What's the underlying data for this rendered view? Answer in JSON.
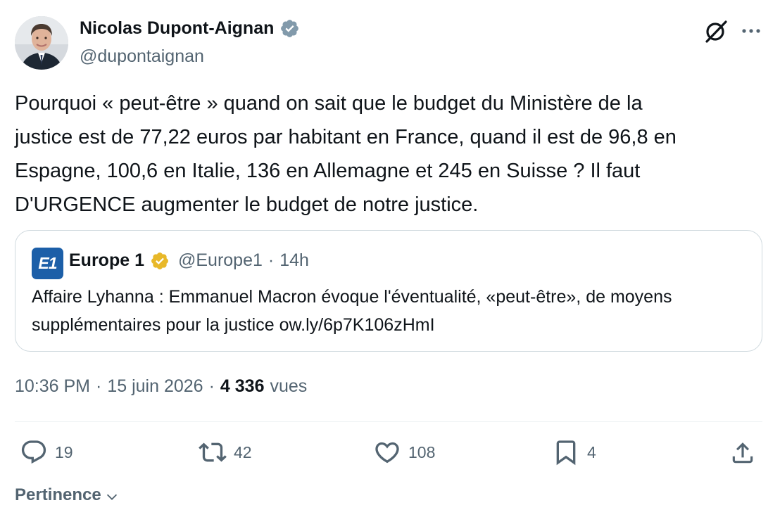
{
  "author": {
    "display_name": "Nicolas Dupont-Aignan",
    "handle": "@dupontaignan",
    "verified_color": "#829aab"
  },
  "tweet": {
    "text": "Pourquoi « peut-être » quand on sait que le budget du Ministère de la\njustice est de 77,22 euros par habitant en France, quand il est de 96,8 en\nEspagne, 100,6 en Italie, 136 en Allemagne et 245 en Suisse ? Il faut\nD'URGENCE augmenter le budget de notre justice."
  },
  "quote": {
    "logo_text": "E1",
    "logo_color": "#1c5fa8",
    "name": "Europe 1",
    "verified_color": "#e8b829",
    "handle": "@Europe1",
    "separator": "·",
    "time": "14h",
    "text": "Affaire Lyhanna : Emmanuel Macron évoque l'éventualité, «peut-être», de moyens supplémentaires pour la justice ow.ly/6p7K106zHmI"
  },
  "meta": {
    "time": "10:36 PM",
    "sep1": "·",
    "date": "15 juin 2026",
    "sep2": "·",
    "views_count": "4 336",
    "views_label": "vues"
  },
  "actions": {
    "replies": "19",
    "reposts": "42",
    "likes": "108",
    "bookmarks": "4"
  },
  "icons": {
    "reply": "reply-bubble-icon",
    "repost": "repost-arrows-icon",
    "like": "heart-icon",
    "bookmark": "bookmark-icon",
    "share": "share-upload-icon",
    "grok": "grok-slash-icon",
    "more": "more-dots-icon"
  },
  "sort": {
    "label": "Pertinence"
  }
}
